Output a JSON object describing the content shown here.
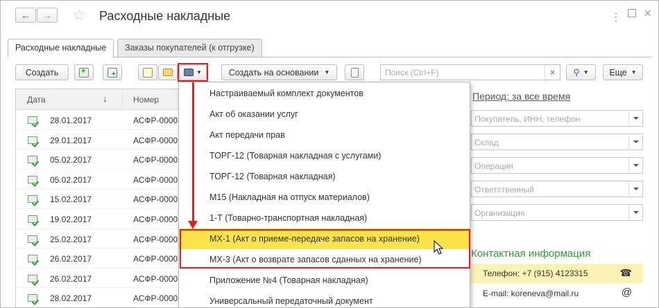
{
  "window": {
    "title": "Расходные накладные"
  },
  "tabs": [
    {
      "label": "Расходные накладные"
    },
    {
      "label": "Заказы покупателей (к отгрузке)"
    }
  ],
  "toolbar": {
    "create_label": "Создать",
    "create_basis_label": "Создать на основании",
    "search_placeholder": "Поиск (Ctrl+F)",
    "clear_label": "×",
    "more_label": "Еще"
  },
  "list": {
    "columns": [
      "Дата",
      "Номер"
    ],
    "sort_indicator": "↓",
    "rows": [
      {
        "date": "28.01.2017",
        "number": "АСФР-0000"
      },
      {
        "date": "29.01.2017",
        "number": "АСФР-0000"
      },
      {
        "date": "05.02.2017",
        "number": "АСФР-0000"
      },
      {
        "date": "05.02.2017",
        "number": "АСФР-0000"
      },
      {
        "date": "15.02.2017",
        "number": "АСФР-0000"
      },
      {
        "date": "19.02.2017",
        "number": "АСФР-0000"
      },
      {
        "date": "25.02.2017",
        "number": "АСФР-0000"
      },
      {
        "date": "26.02.2017",
        "number": "АСФР-0000"
      },
      {
        "date": "26.02.2017",
        "number": "АСФР-0000"
      },
      {
        "date": "28.02.2017",
        "number": "АСФР-0000"
      }
    ]
  },
  "print_menu": {
    "items": [
      {
        "label": "Настраиваемый комплект документов"
      },
      {
        "label": "Акт об оказании услуг"
      },
      {
        "label": "Акт передачи прав"
      },
      {
        "label": "ТОРГ-12 (Товарная накладная с услугами)"
      },
      {
        "label": "ТОРГ-12 (Товарная накладная)"
      },
      {
        "label": "М15 (Накладная на отпуск материалов)"
      },
      {
        "label": "1-Т (Товарно-транспортная накладная)"
      },
      {
        "label": "МХ-1 (Акт о приеме-передаче запасов на хранение)"
      },
      {
        "label": "МХ-3 (Акт о возврате запасов сданных на хранение)"
      },
      {
        "label": "Приложение №4 (Товарная накладная)"
      },
      {
        "label": "Универсальный передаточный документ"
      }
    ]
  },
  "filters": {
    "period": "Период: за все время",
    "buyer_placeholder": "Покупатель, ИНН, телефон",
    "warehouse_placeholder": "Склад",
    "operation_placeholder": "Операция",
    "responsible_placeholder": "Ответственный",
    "organization_placeholder": "Организация"
  },
  "contact": {
    "title": "Контактная информация",
    "phone": "Телефон: +7 (915) 4123315",
    "email": "E-mail:  koreneva@mail.ru",
    "phone_icon": "☎",
    "email_icon": "@"
  },
  "colors": {
    "highlight": "#fbe34c",
    "annotation_red": "#e02020",
    "contact_green": "#2e9a3e",
    "phone_bg": "#fbf3b4"
  }
}
